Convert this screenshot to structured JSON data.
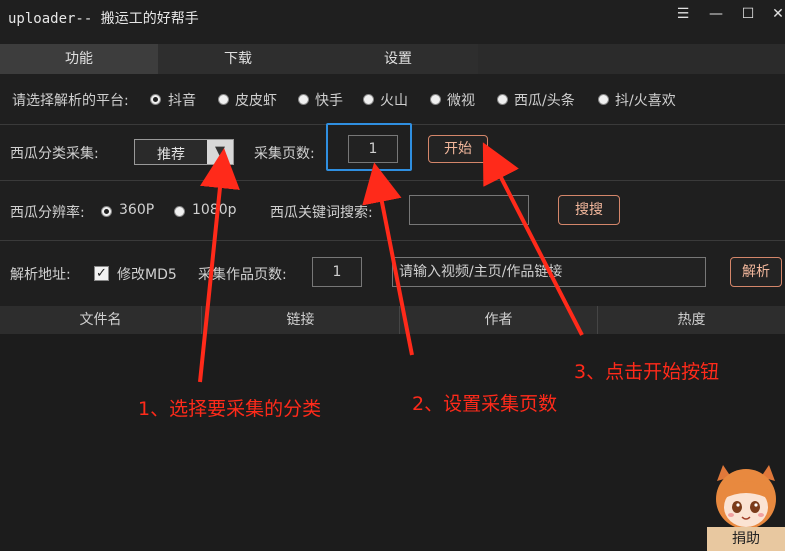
{
  "window": {
    "title": "uploader-- 搬运工的好帮手",
    "menu_icon": "menu-icon",
    "minimize_icon": "minimize-icon",
    "maximize_icon": "maximize-icon",
    "close_icon": "close-icon"
  },
  "tabs": [
    {
      "label": "功能",
      "active": true
    },
    {
      "label": "下载",
      "active": false
    },
    {
      "label": "设置",
      "active": false
    }
  ],
  "platform": {
    "label": "请选择解析的平台:",
    "options": [
      {
        "label": "抖音",
        "checked": true
      },
      {
        "label": "皮皮虾",
        "checked": false
      },
      {
        "label": "快手",
        "checked": false
      },
      {
        "label": "火山",
        "checked": false
      },
      {
        "label": "微视",
        "checked": false
      },
      {
        "label": "西瓜/头条",
        "checked": false
      },
      {
        "label": "抖/火喜欢",
        "checked": false
      }
    ]
  },
  "xigua_category": {
    "label": "西瓜分类采集:",
    "selected": "推荐",
    "pages_label": "采集页数:",
    "pages_value": "1",
    "start_button": "开始"
  },
  "resolution": {
    "label": "西瓜分辨率:",
    "options": [
      {
        "label": "360P",
        "checked": true
      },
      {
        "label": "1080p",
        "checked": false
      }
    ],
    "keyword_label": "西瓜关键词搜索:",
    "keyword_value": "",
    "search_button": "搜搜"
  },
  "parse": {
    "label": "解析地址:",
    "md5_label": "修改MD5",
    "md5_checked": true,
    "pages_label": "采集作品页数:",
    "pages_value": "1",
    "url_placeholder": "请输入视频/主页/作品链接",
    "parse_button": "解析"
  },
  "table": {
    "columns": [
      "文件名",
      "链接",
      "作者",
      "热度"
    ]
  },
  "annotations": {
    "step1": "1、选择要采集的分类",
    "step2": "2、设置采集页数",
    "step3": "3、点击开始按钮",
    "color": "#ff2a1a"
  },
  "donate": {
    "label": "捐助"
  }
}
